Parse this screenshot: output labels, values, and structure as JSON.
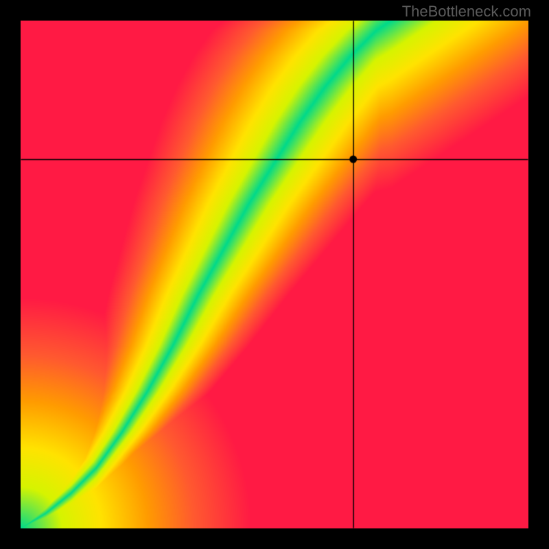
{
  "watermark": "TheBottleneck.com",
  "chart_data": {
    "type": "heatmap",
    "title": "",
    "xlabel": "",
    "ylabel": "",
    "xlim": [
      0,
      1
    ],
    "ylim": [
      0,
      1
    ],
    "crosshair": {
      "x": 0.655,
      "y": 0.727
    },
    "marker": {
      "x": 0.655,
      "y": 0.727
    },
    "ridge_path": [
      {
        "x": 0.0,
        "y": 0.0
      },
      {
        "x": 0.05,
        "y": 0.03
      },
      {
        "x": 0.1,
        "y": 0.07
      },
      {
        "x": 0.15,
        "y": 0.12
      },
      {
        "x": 0.2,
        "y": 0.19
      },
      {
        "x": 0.25,
        "y": 0.27
      },
      {
        "x": 0.3,
        "y": 0.36
      },
      {
        "x": 0.35,
        "y": 0.46
      },
      {
        "x": 0.4,
        "y": 0.55
      },
      {
        "x": 0.45,
        "y": 0.64
      },
      {
        "x": 0.5,
        "y": 0.72
      },
      {
        "x": 0.55,
        "y": 0.8
      },
      {
        "x": 0.6,
        "y": 0.87
      },
      {
        "x": 0.65,
        "y": 0.93
      },
      {
        "x": 0.7,
        "y": 0.98
      },
      {
        "x": 0.73,
        "y": 1.0
      }
    ],
    "color_stops": [
      {
        "t": 0.0,
        "color": "#00d98b"
      },
      {
        "t": 0.18,
        "color": "#d6f400"
      },
      {
        "t": 0.35,
        "color": "#ffe300"
      },
      {
        "t": 0.55,
        "color": "#ff9c00"
      },
      {
        "t": 0.75,
        "color": "#ff5a2f"
      },
      {
        "t": 1.0,
        "color": "#ff1a44"
      }
    ],
    "ridge_halfwidth_start": 0.008,
    "ridge_halfwidth_end": 0.055
  }
}
